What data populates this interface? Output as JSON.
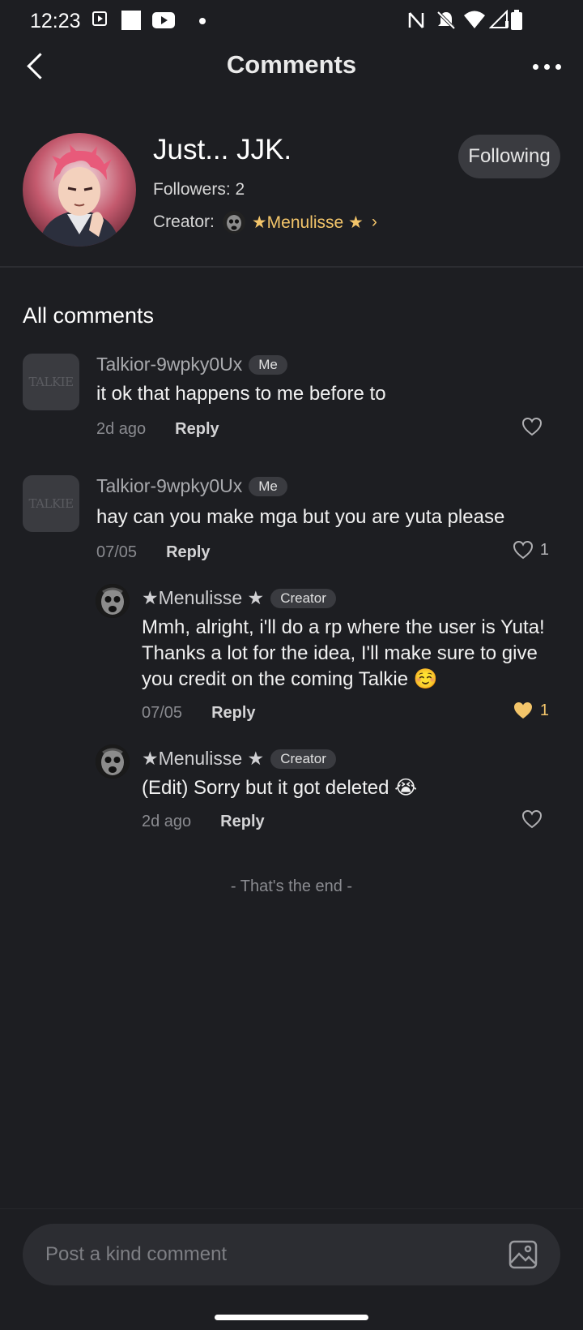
{
  "status_bar": {
    "time": "12:23"
  },
  "header": {
    "title": "Comments"
  },
  "bot": {
    "name": "Just... JJK.",
    "followers": "Followers: 2",
    "creator_label": "Creator:",
    "creator_name": "★Menulisse ★",
    "follow_label": "Following"
  },
  "comments_section": {
    "title": "All comments"
  },
  "comments": [
    {
      "user": "Talkior-9wpky0Ux",
      "badge": "Me",
      "avatar_text": "TALKIE",
      "text": "it ok that happens to me before to",
      "time": "2d ago",
      "reply": "Reply",
      "likes": "",
      "liked": false
    },
    {
      "user": "Talkior-9wpky0Ux",
      "badge": "Me",
      "avatar_text": "TALKIE",
      "text": "hay can you make mga but you are yuta please",
      "time": "07/05",
      "reply": "Reply",
      "likes": "1",
      "liked": false
    },
    {
      "user": "★Menulisse ★",
      "badge": "Creator",
      "text": "Mmh, alright, i'll do a rp where the user is Yuta! Thanks a lot for the idea, I'll make sure to give you credit on the coming Talkie ☺️",
      "time": "07/05",
      "reply": "Reply",
      "likes": "1",
      "liked": true
    },
    {
      "user": "★Menulisse ★",
      "badge": "Creator",
      "text": "(Edit) Sorry but it got deleted 😭",
      "time": "2d ago",
      "reply": "Reply",
      "likes": "",
      "liked": false
    }
  ],
  "end_text": "- That's the end -",
  "input": {
    "placeholder": "Post a kind comment"
  },
  "colors": {
    "background": "#1d1e22",
    "accent_gold": "#f3c56a",
    "surface": "#2c2d32"
  },
  "icons": {
    "back": "back-arrow-icon",
    "more": "more-options-icon",
    "like": "heart-icon",
    "image": "image-icon"
  }
}
